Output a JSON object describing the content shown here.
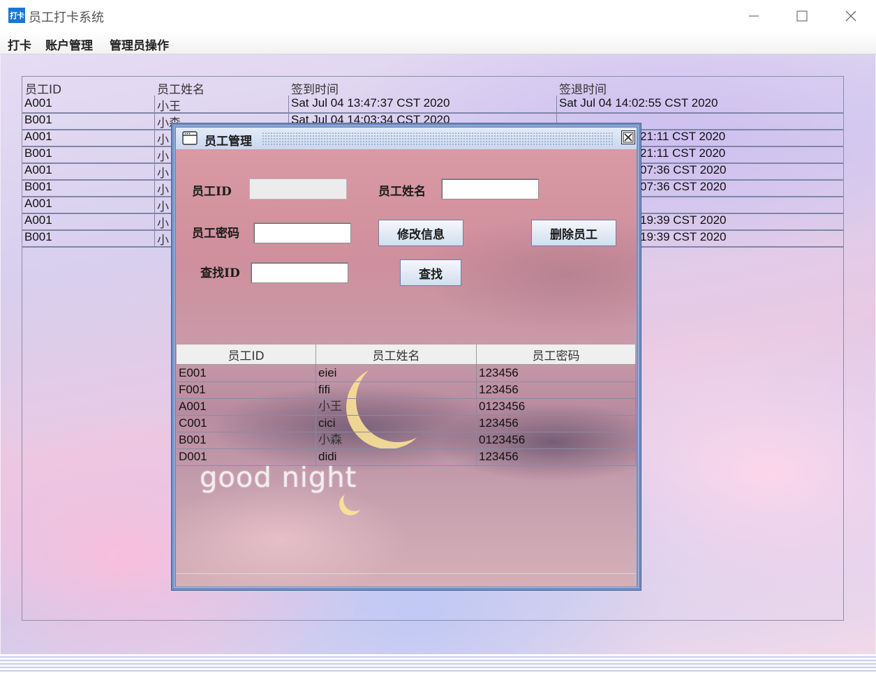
{
  "window": {
    "title": "员工打卡系统",
    "icon_text": "打卡"
  },
  "menubar": {
    "items": [
      "打卡",
      "账户管理",
      "管理员操作"
    ]
  },
  "main_table": {
    "columns": [
      "员工ID",
      "员工姓名",
      "签到时间",
      "签退时间"
    ],
    "rows": [
      [
        "A001",
        "小王",
        "Sat Jul 04 13:47:37 CST 2020",
        "Sat Jul 04 14:02:55 CST 2020"
      ],
      [
        "B001",
        "小森",
        "Sat Jul 04 14:03:34 CST 2020",
        ""
      ],
      [
        "A001",
        "小",
        "",
        "21:11 CST 2020"
      ],
      [
        "B001",
        "小",
        "",
        "21:11 CST 2020"
      ],
      [
        "A001",
        "小",
        "",
        "07:36 CST 2020"
      ],
      [
        "B001",
        "小",
        "",
        "07:36 CST 2020"
      ],
      [
        "A001",
        "小",
        "",
        ""
      ],
      [
        "A001",
        "小",
        "",
        "19:39 CST 2020"
      ],
      [
        "B001",
        "小",
        "",
        "19:39 CST 2020"
      ]
    ]
  },
  "employee_dialog": {
    "title": "员工管理",
    "labels": {
      "emp_id": "员工ID",
      "emp_name": "员工姓名",
      "emp_password": "员工密码",
      "find_id": "查找ID"
    },
    "fields": {
      "emp_id": "",
      "emp_name": "",
      "emp_password": "",
      "find_id": ""
    },
    "buttons": {
      "modify": "修改信息",
      "delete": "删除员工",
      "find": "查找"
    },
    "table": {
      "columns": [
        "员工ID",
        "员工姓名",
        "员工密码"
      ],
      "rows": [
        [
          "E001",
          "eiei",
          "123456"
        ],
        [
          "F001",
          "fifi",
          "123456"
        ],
        [
          "A001",
          "小王",
          "0123456"
        ],
        [
          "C001",
          "cici",
          "123456"
        ],
        [
          "B001",
          "小森",
          "0123456"
        ],
        [
          "D001",
          "didi",
          "123456"
        ]
      ]
    },
    "background_text": "good night"
  }
}
